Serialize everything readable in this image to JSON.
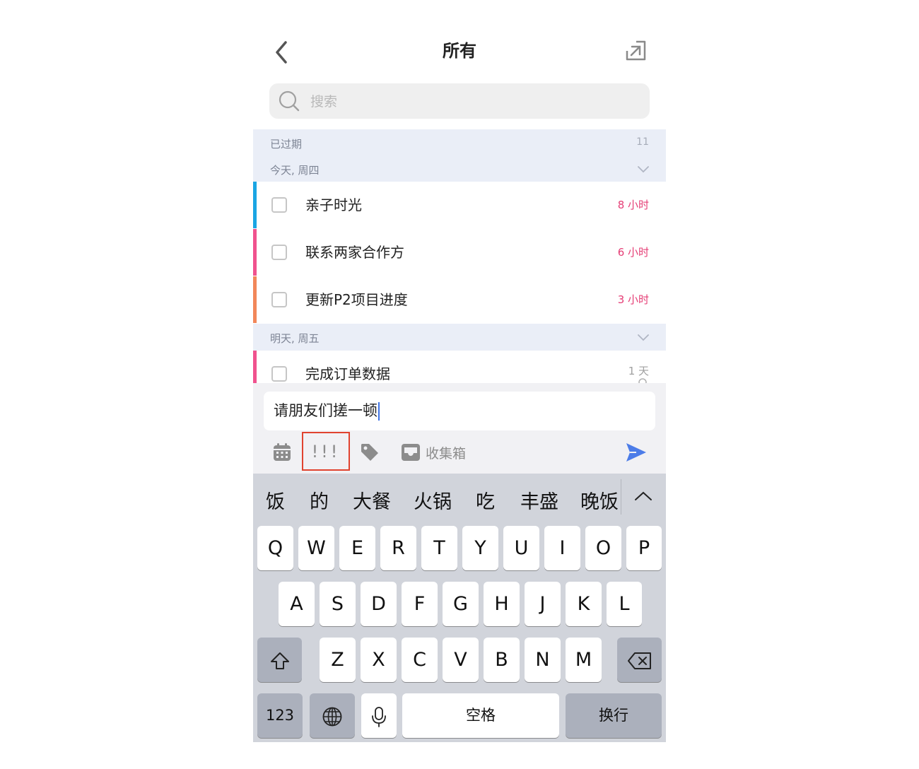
{
  "header": {
    "title": "所有"
  },
  "search": {
    "placeholder": "搜索"
  },
  "sections": {
    "overdue": {
      "label": "已过期",
      "count": "11"
    },
    "today": {
      "label": "今天, 周四"
    },
    "tomorrow": {
      "label": "明天, 周五"
    }
  },
  "tasks": [
    {
      "label": "亲子时光",
      "time": "8 小时",
      "color": "#1aa5e3"
    },
    {
      "label": "联系两家合作方",
      "time": "6 小时",
      "color": "#f0528e"
    },
    {
      "label": "更新P2项目进度",
      "time": "3 小时",
      "color": "#f2875a"
    },
    {
      "label": "完成订单数据",
      "time": "1 天",
      "color": "#f0528e"
    }
  ],
  "composer": {
    "text": "请朋友们搓一顿",
    "priority_label": "!!!",
    "list_label": "收集箱"
  },
  "keyboard": {
    "candidates": [
      "饭",
      "的",
      "大餐",
      "火锅",
      "吃",
      "丰盛",
      "晚饭"
    ],
    "row1": [
      "Q",
      "W",
      "E",
      "R",
      "T",
      "Y",
      "U",
      "I",
      "O",
      "P"
    ],
    "row2": [
      "A",
      "S",
      "D",
      "F",
      "G",
      "H",
      "J",
      "K",
      "L"
    ],
    "row3": [
      "Z",
      "X",
      "C",
      "V",
      "B",
      "N",
      "M"
    ],
    "numbers_label": "123",
    "space_label": "空格",
    "return_label": "换行"
  },
  "colors": {
    "accent": "#4c7ce8",
    "due_time": "#e53d75",
    "highlight_box": "#e0432f",
    "section_bg": "#eaeef7"
  }
}
